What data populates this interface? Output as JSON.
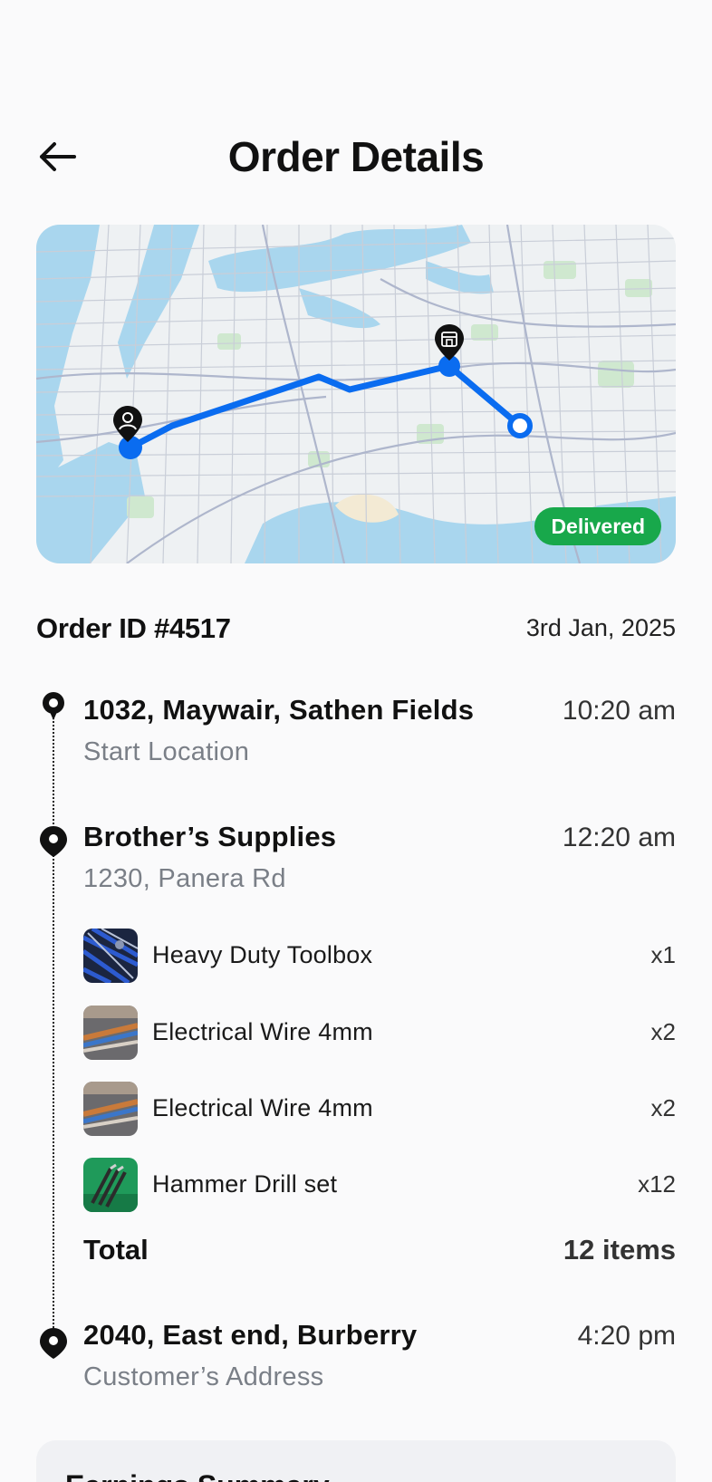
{
  "header": {
    "title": "Order Details",
    "back_icon": "arrow-left-icon"
  },
  "map": {
    "status_badge": "Delivered",
    "status_color": "#18a84b",
    "route_color": "#0a6cf0",
    "icons": [
      "user-pin-icon",
      "store-pin-icon",
      "destination-dot-icon"
    ]
  },
  "order": {
    "id_label": "Order ID #4517",
    "date": "3rd Jan, 2025"
  },
  "timeline": {
    "start": {
      "title": "1032, Maywair, Sathen Fields",
      "subtitle": "Start Location",
      "time": "10:20 am"
    },
    "pickup": {
      "title": "Brother’s Supplies",
      "subtitle": "1230, Panera Rd",
      "time": "12:20 am",
      "items": [
        {
          "name": "Heavy Duty Toolbox",
          "qty": "x1"
        },
        {
          "name": "Electrical Wire 4mm",
          "qty": "x2"
        },
        {
          "name": "Electrical Wire 4mm",
          "qty": "x2"
        },
        {
          "name": "Hammer Drill set",
          "qty": "x12"
        }
      ],
      "total_label": "Total",
      "total_value": "12 items"
    },
    "dropoff": {
      "title": "2040, East end, Burberry",
      "subtitle": "Customer’s Address",
      "time": "4:20 pm"
    }
  },
  "earnings": {
    "title": "Earnings Summary"
  }
}
